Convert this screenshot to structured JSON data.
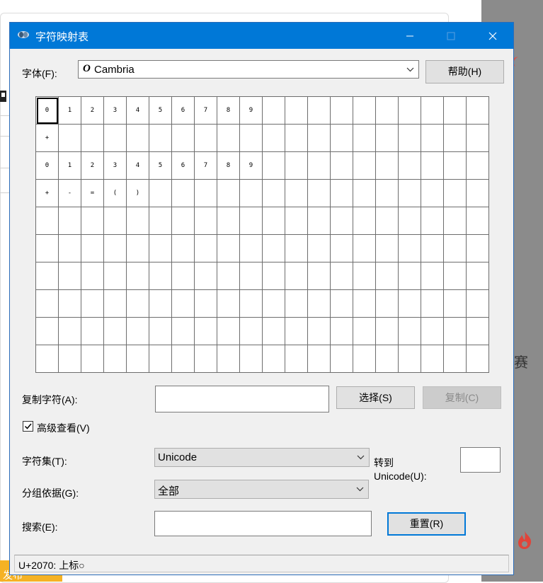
{
  "window": {
    "title": "字符映射表"
  },
  "font": {
    "label": "字体(F):",
    "glyph": "O",
    "value": "Cambria"
  },
  "help_button": "帮助(H)",
  "grid": {
    "rows": [
      [
        "0",
        "1",
        "2",
        "3",
        "4",
        "5",
        "6",
        "7",
        "8",
        "9",
        "",
        "",
        "",
        "",
        "",
        "",
        "",
        "",
        "",
        ""
      ],
      [
        "+",
        "",
        "",
        "",
        "",
        "",
        "",
        "",
        "",
        "",
        "",
        "",
        "",
        "",
        "",
        "",
        "",
        "",
        "",
        ""
      ],
      [
        "0",
        "1",
        "2",
        "3",
        "4",
        "5",
        "6",
        "7",
        "8",
        "9",
        "",
        "",
        "",
        "",
        "",
        "",
        "",
        "",
        "",
        ""
      ],
      [
        "+",
        "-",
        "=",
        "(",
        ")",
        "",
        "",
        "",
        "",
        "",
        "",
        "",
        "",
        "",
        "",
        "",
        "",
        "",
        "",
        ""
      ],
      [
        "",
        "",
        "",
        "",
        "",
        "",
        "",
        "",
        "",
        "",
        "",
        "",
        "",
        "",
        "",
        "",
        "",
        "",
        "",
        ""
      ],
      [
        "",
        "",
        "",
        "",
        "",
        "",
        "",
        "",
        "",
        "",
        "",
        "",
        "",
        "",
        "",
        "",
        "",
        "",
        "",
        ""
      ],
      [
        "",
        "",
        "",
        "",
        "",
        "",
        "",
        "",
        "",
        "",
        "",
        "",
        "",
        "",
        "",
        "",
        "",
        "",
        "",
        ""
      ],
      [
        "",
        "",
        "",
        "",
        "",
        "",
        "",
        "",
        "",
        "",
        "",
        "",
        "",
        "",
        "",
        "",
        "",
        "",
        "",
        ""
      ],
      [
        "",
        "",
        "",
        "",
        "",
        "",
        "",
        "",
        "",
        "",
        "",
        "",
        "",
        "",
        "",
        "",
        "",
        "",
        "",
        ""
      ],
      [
        "",
        "",
        "",
        "",
        "",
        "",
        "",
        "",
        "",
        "",
        "",
        "",
        "",
        "",
        "",
        "",
        "",
        "",
        "",
        ""
      ]
    ]
  },
  "copy": {
    "label": "复制字符(A):",
    "value": "",
    "select_button": "选择(S)",
    "copy_button": "复制(C)"
  },
  "advanced": {
    "label": "高级查看(V)",
    "checked": true
  },
  "charset": {
    "label": "字符集(T):",
    "value": "Unicode"
  },
  "goto": {
    "label_line1": "转到",
    "label_line2": "Unicode(U):",
    "value": ""
  },
  "group": {
    "label": "分组依据(G):",
    "value": "全部"
  },
  "search": {
    "label": "搜索(E):",
    "value": "",
    "reset_button": "重置(R)"
  },
  "status": {
    "text": "U+2070: 上标○"
  },
  "background": {
    "side_char": "赛",
    "publish_fragment": "发布"
  },
  "colors": {
    "titlebar": "#0078d7",
    "dialog": "#f0f0f0",
    "accent": "#0078d7"
  }
}
